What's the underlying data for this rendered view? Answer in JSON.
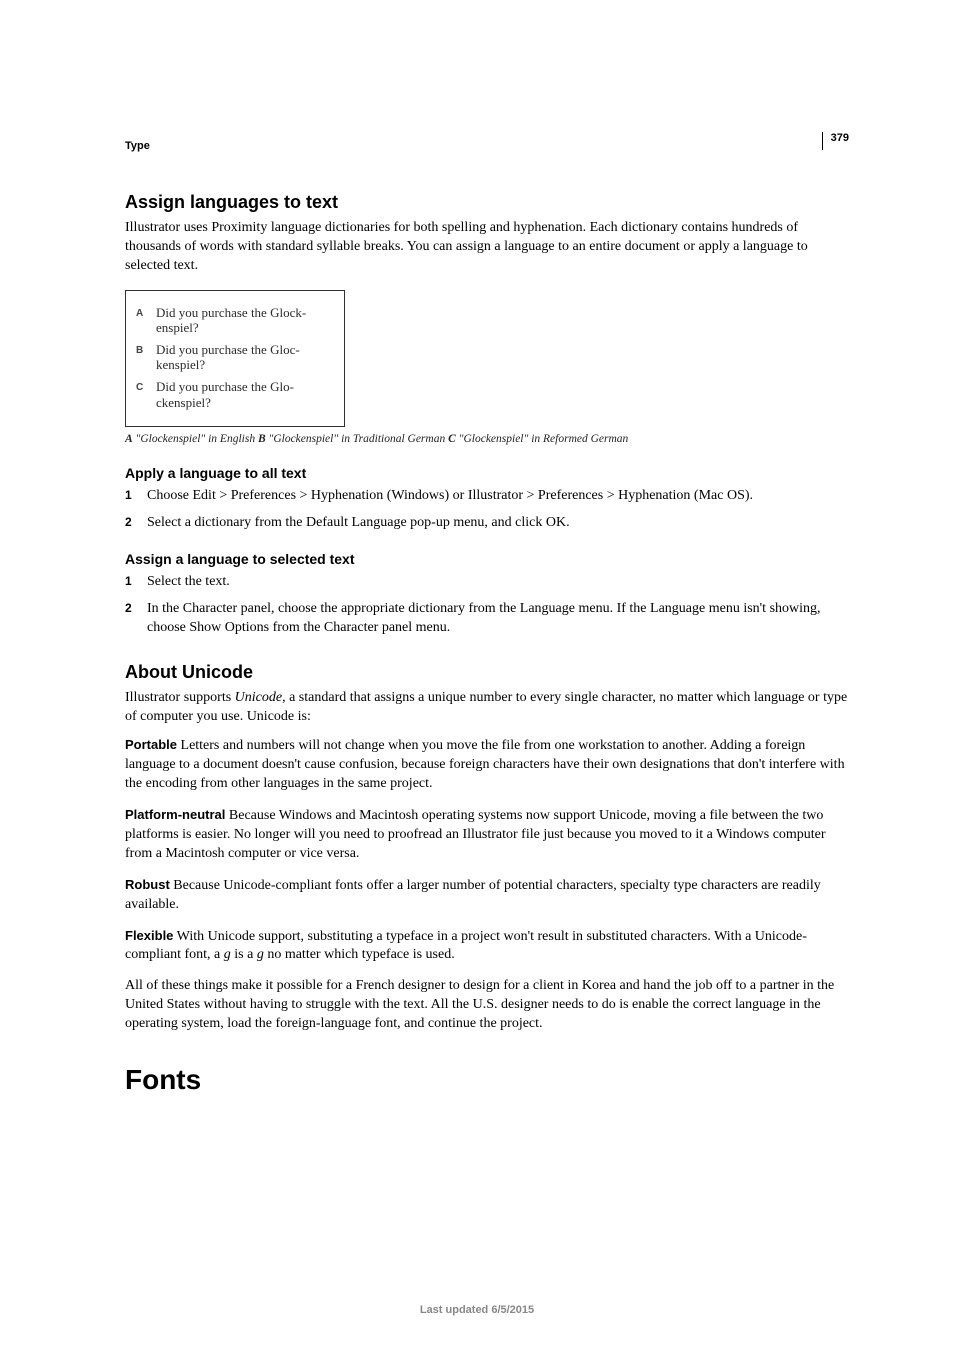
{
  "header": {
    "chapter": "Type",
    "page_number": "379"
  },
  "section1": {
    "title": "Assign languages to text",
    "intro": "Illustrator uses Proximity language dictionaries for both spelling and hyphenation. Each dictionary contains hundreds of thousands of words with standard syllable breaks. You can assign a language to an entire document or apply a language to selected text.",
    "figure": {
      "rows": [
        {
          "label": "A",
          "line1": "Did you purchase the Glock-",
          "line2": "enspiel?"
        },
        {
          "label": "B",
          "line1": "Did you purchase the Gloc-",
          "line2": "kenspiel?"
        },
        {
          "label": "C",
          "line1": "Did you purchase the Glo-",
          "line2": "ckenspiel?"
        }
      ]
    },
    "caption": {
      "a_label": "A",
      "a_text": " \"Glockenspiel\" in English  ",
      "b_label": "B",
      "b_text": " \"Glockenspiel\" in Traditional German  ",
      "c_label": "C",
      "c_text": " \"Glockenspiel\" in Reformed German"
    },
    "sub1": {
      "title": "Apply a language to all text",
      "steps": [
        "Choose Edit > Preferences > Hyphenation (Windows) or Illustrator > Preferences > Hyphenation (Mac OS).",
        "Select a dictionary from the Default Language pop-up menu, and click OK."
      ]
    },
    "sub2": {
      "title": "Assign a language to selected text",
      "steps": [
        "Select the text.",
        "In the Character panel, choose the appropriate dictionary from the Language menu. If the Language menu isn't showing, choose Show Options from the Character panel menu."
      ]
    }
  },
  "section2": {
    "title": "About Unicode",
    "intro_pre": "Illustrator supports ",
    "intro_em": "Unicode",
    "intro_post": ", a standard that assigns a unique number to every single character, no matter which language or type of computer you use. Unicode is:",
    "defs": [
      {
        "term": "Portable",
        "text": "  Letters and numbers will not change when you move the file from one workstation to another. Adding a foreign language to a document doesn't cause confusion, because foreign characters have their own designations that don't interfere with the encoding from other languages in the same project."
      },
      {
        "term": "Platform-neutral",
        "text": "   Because Windows and Macintosh operating systems now support Unicode, moving a file between the two platforms is easier. No longer will you need to proofread an Illustrator file just because you moved to it a Windows computer from a Macintosh computer or vice versa."
      },
      {
        "term": "Robust",
        "text": "   Because Unicode-compliant fonts offer a larger number of potential characters, specialty type characters are readily available."
      },
      {
        "term": "Flexible",
        "text_pre": "   With Unicode support, substituting a typeface in a project won't result in substituted characters. With a Unicode-compliant font, a ",
        "g1": "g",
        "mid": " is a ",
        "g2": "g",
        "text_post": " no matter which typeface is used."
      }
    ],
    "closing": "All of these things make it possible for a French designer to design for a client in Korea and hand the job off to a partner in the United States without having to struggle with the text. All the U.S. designer needs to do is enable the correct language in the operating system, load the foreign-language font, and continue the project."
  },
  "chapter_title": "Fonts",
  "footer": "Last updated 6/5/2015"
}
